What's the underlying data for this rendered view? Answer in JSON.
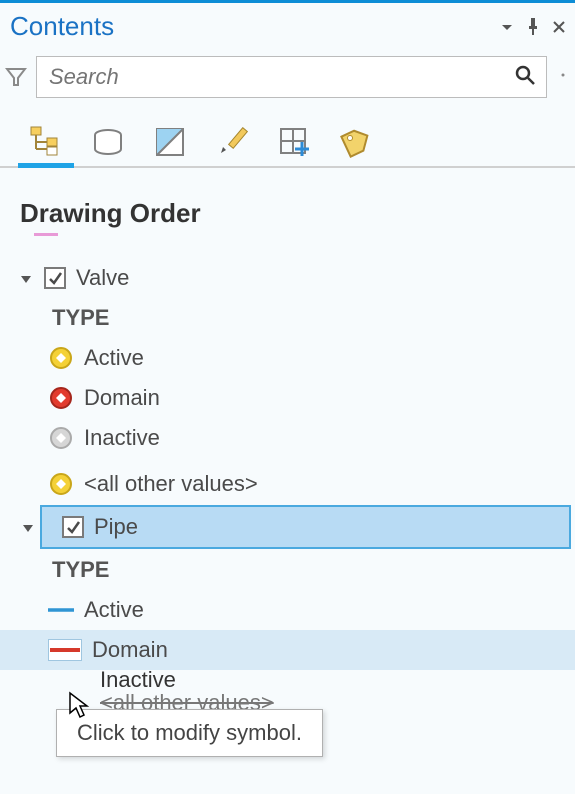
{
  "panel": {
    "title": "Contents"
  },
  "search": {
    "placeholder": "Search"
  },
  "section": {
    "heading": "Drawing Order"
  },
  "layers": [
    {
      "name": "Valve",
      "checked": true,
      "expanded": true,
      "symbology_field": "TYPE",
      "classes": [
        {
          "label": "Active",
          "symbol": "circle-yellow"
        },
        {
          "label": "Domain",
          "symbol": "circle-red"
        },
        {
          "label": "Inactive",
          "symbol": "circle-grey"
        },
        {
          "label": "<all other values>",
          "symbol": "circle-yellow"
        }
      ]
    },
    {
      "name": "Pipe",
      "checked": true,
      "expanded": true,
      "selected": true,
      "symbology_field": "TYPE",
      "classes": [
        {
          "label": "Active",
          "symbol": "line-blue"
        },
        {
          "label": "Domain",
          "symbol": "line-red",
          "hover": true
        },
        {
          "label": "Inactive",
          "symbol": "line-grey",
          "truncated": true
        }
      ],
      "footer": "<all other values>"
    }
  ],
  "tooltip": "Click to modify symbol.",
  "tabs": {
    "drawing_order": "drawing-order-tab",
    "source": "list-by-source-tab",
    "selection": "list-by-selection-tab",
    "editing": "list-by-editing-tab",
    "snapping": "list-by-snapping-tab",
    "labeling": "list-by-labeling-tab"
  },
  "colors": {
    "accent": "#1fa3e6",
    "selection_fill": "#b8dbf4",
    "selection_border": "#4aa9df"
  }
}
